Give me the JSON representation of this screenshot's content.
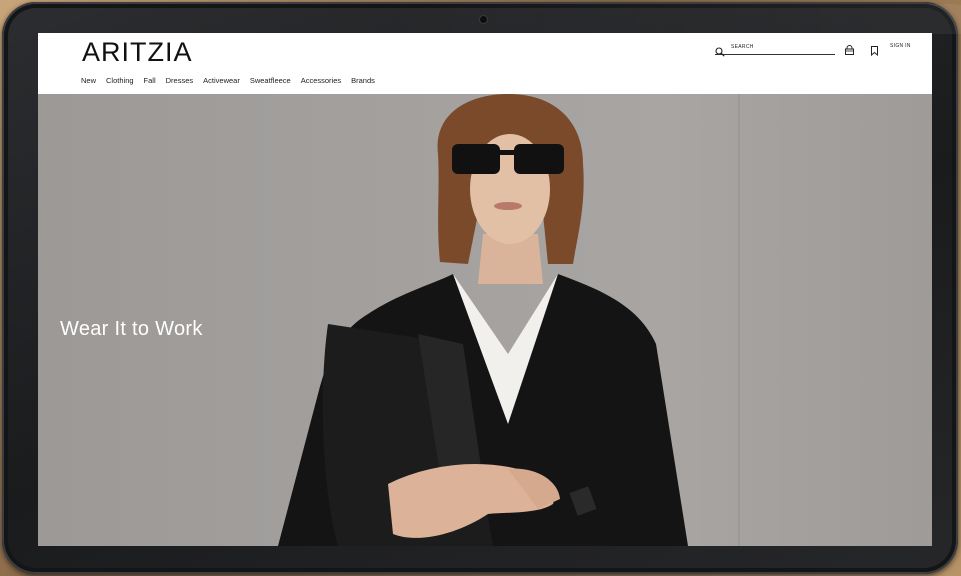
{
  "brand": {
    "logo": "ARITZIA"
  },
  "nav": {
    "items": [
      {
        "label": "New"
      },
      {
        "label": "Clothing"
      },
      {
        "label": "Fall"
      },
      {
        "label": "Dresses"
      },
      {
        "label": "Activewear"
      },
      {
        "label": "Sweatfleece"
      },
      {
        "label": "Accessories"
      },
      {
        "label": "Brands"
      }
    ]
  },
  "header": {
    "search_label": "SEARCH",
    "signin_label": "SIGN IN",
    "icons": [
      "search-icon",
      "bag-icon",
      "bookmark-icon"
    ]
  },
  "hero": {
    "caption": "Wear It to Work"
  },
  "colors": {
    "hero_background": "#a4a19f",
    "header_background": "#ffffff",
    "caption_text": "#ffffff",
    "device_frame": "#222326"
  }
}
